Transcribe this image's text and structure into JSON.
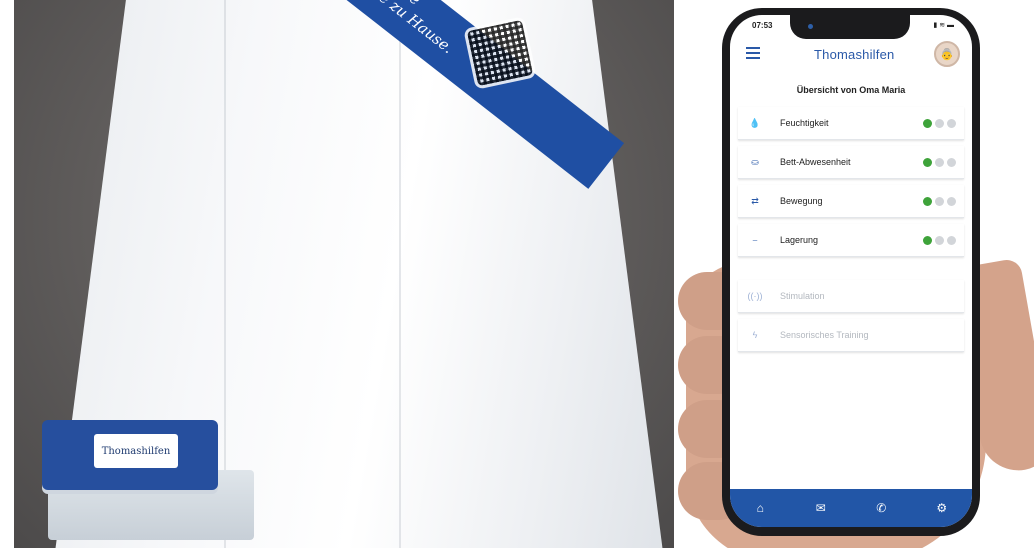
{
  "left_photo": {
    "sheet_band_text": "et die\nge zu Hause.",
    "device_logo_text": "Thomashilfen"
  },
  "phone": {
    "status_time": "07:53",
    "status_icons": "▮ ≋ ▬",
    "logo_text": "Thomashilfen",
    "overview_title": "Übersicht von Oma Maria",
    "items": [
      {
        "label": "Feuchtigkeit",
        "icon": "droplets-icon",
        "glyph": "💧",
        "status": [
          "green",
          "grey",
          "grey"
        ],
        "enabled": true
      },
      {
        "label": "Bett-Abwesenheit",
        "icon": "bed-exit-icon",
        "glyph": "⛀",
        "status": [
          "green",
          "grey",
          "grey"
        ],
        "enabled": true
      },
      {
        "label": "Bewegung",
        "icon": "motion-icon",
        "glyph": "⇄",
        "status": [
          "green",
          "grey",
          "grey"
        ],
        "enabled": true
      },
      {
        "label": "Lagerung",
        "icon": "positioning-icon",
        "glyph": "⎯",
        "status": [
          "green",
          "grey",
          "grey"
        ],
        "enabled": true
      },
      {
        "label": "Stimulation",
        "icon": "stimulation-icon",
        "glyph": "((·))",
        "enabled": false
      },
      {
        "label": "Sensorisches Training",
        "icon": "sensory-training-icon",
        "glyph": "ϟ",
        "enabled": false
      }
    ],
    "nav": [
      {
        "name": "home-icon",
        "glyph": "⌂"
      },
      {
        "name": "mail-icon",
        "glyph": "✉"
      },
      {
        "name": "phone-icon",
        "glyph": "✆"
      },
      {
        "name": "settings-icon",
        "glyph": "⚙"
      }
    ],
    "colors": {
      "brand_blue": "#2256a7",
      "status_green": "#3ea33a",
      "status_grey": "#d2d5d9"
    }
  }
}
